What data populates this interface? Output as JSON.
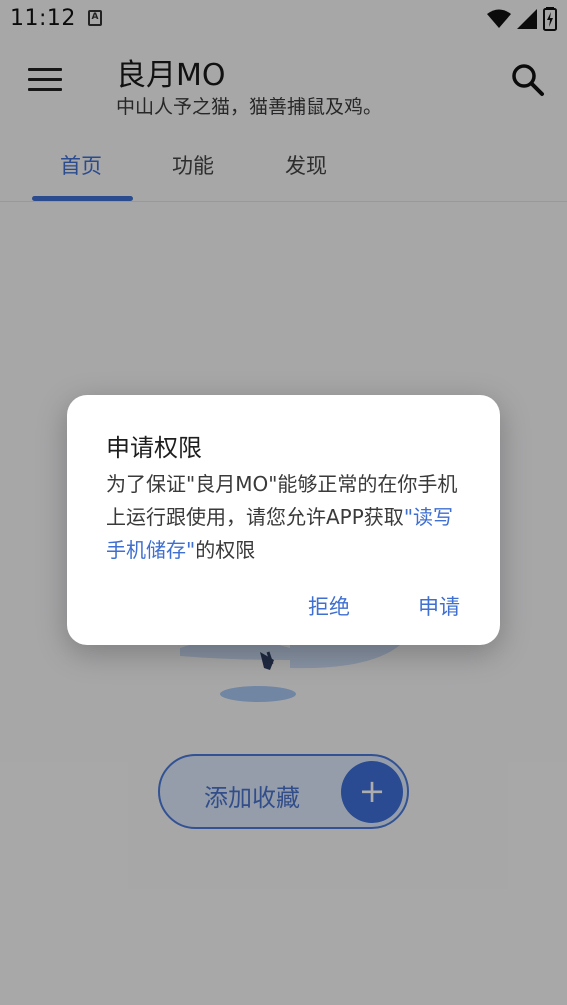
{
  "status_bar": {
    "time": "11:12",
    "notification_icon_letter": "A",
    "icons": [
      "wifi-icon",
      "signal-icon",
      "battery-charging-icon"
    ]
  },
  "app_bar": {
    "title": "良月MO",
    "subtitle": "中山人予之猫，猫善捕鼠及鸡。"
  },
  "tabs": [
    {
      "label": "首页",
      "active": true
    },
    {
      "label": "功能",
      "active": false
    },
    {
      "label": "发现",
      "active": false
    }
  ],
  "main": {
    "add_favorite_label": "添加收藏",
    "add_favorite_plus": "+"
  },
  "dialog": {
    "title": "申请权限",
    "body_part1": "为了保证\"良月MO\"能够正常的在你手机上运行跟使用，请您允许APP获取",
    "body_highlight": "\"读写手机储存\"",
    "body_part2": "的权限",
    "deny_label": "拒绝",
    "apply_label": "申请"
  },
  "colors": {
    "accent": "#3f6fd0",
    "background": "#f7f7f8",
    "scrim": "rgba(0,0,0,0.32)"
  }
}
